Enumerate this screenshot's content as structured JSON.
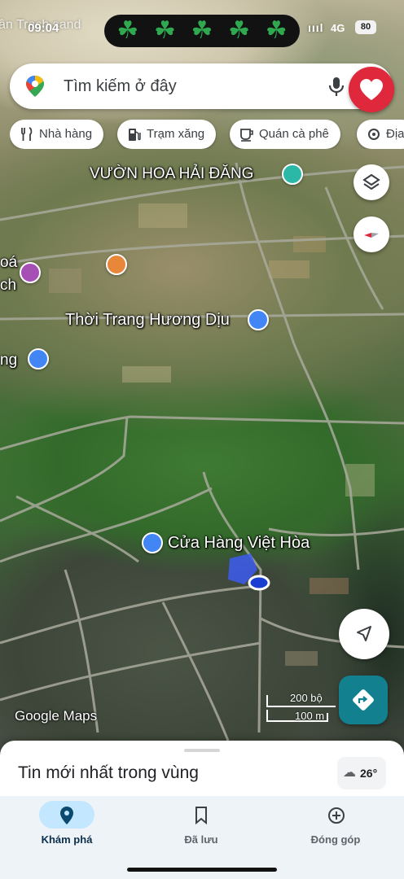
{
  "status_bar": {
    "overlay_text": "ân Trạch sand",
    "time": "09:04",
    "signal": "ıııl",
    "network": "4G",
    "battery": "80",
    "clovers": [
      "☘",
      "☘",
      "☘",
      "☘",
      "☘"
    ]
  },
  "search": {
    "placeholder": "Tìm kiếm ở đây",
    "logo_icon": "maps-pin-icon",
    "mic_icon": "microphone-icon"
  },
  "favorite_button": {
    "icon": "heart-icon",
    "color": "#e0283c"
  },
  "chips": [
    {
      "label": "Nhà hàng",
      "icon": "fork-knife-icon"
    },
    {
      "label": "Trạm xăng",
      "icon": "gas-pump-icon"
    },
    {
      "label": "Quán cà phê",
      "icon": "coffee-cup-icon"
    },
    {
      "label": "Địa",
      "icon": "attraction-icon"
    }
  ],
  "map_labels": {
    "garden": "VƯỜN HOA HẢI ĐĂNG",
    "left_partial_1": "oá",
    "left_partial_2": "ch",
    "shop_fashion": "Thời Trang Hương Dịu",
    "left_partial_3": "ng",
    "shop_viet_hoa": "Cửa Hàng Việt Hòa"
  },
  "map_controls": {
    "layers_icon": "layers-icon",
    "compass_icon": "compass-icon",
    "location_icon": "my-location-arrow-icon",
    "directions_icon": "directions-icon"
  },
  "watermark": "Google Maps",
  "scale_bar": {
    "imperial": "200 bộ",
    "metric": "100 m"
  },
  "sheet": {
    "title": "Tin mới nhất trong vùng",
    "temperature": "26°",
    "weather_icon": "cloud-rain-icon"
  },
  "bottom_nav": [
    {
      "label": "Khám phá",
      "icon": "location-pin-icon",
      "active": true
    },
    {
      "label": "Đã lưu",
      "icon": "bookmark-icon",
      "active": false
    },
    {
      "label": "Đóng góp",
      "icon": "add-circle-icon",
      "active": false
    }
  ],
  "colors": {
    "accent": "#1a73e8",
    "nav_active_bg": "#c2e7ff",
    "directions_bg": "#13808f",
    "poi_pink": "#a64fb4",
    "poi_blue": "#4285f4",
    "poi_orange": "#e8863a",
    "poi_teal": "#2bb8a6"
  }
}
